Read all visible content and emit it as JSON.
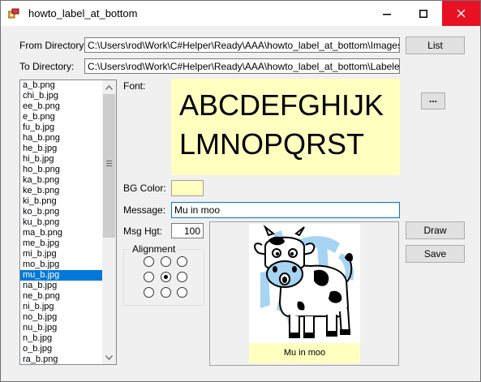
{
  "window": {
    "title": "howto_label_at_bottom",
    "minimize": "—",
    "maximize": "☐",
    "close": "✕"
  },
  "from_directory": {
    "label": "From Directory:",
    "value": "C:\\Users\\rod\\Work\\C#Helper\\Ready\\AAA\\howto_label_at_bottom\\Images"
  },
  "to_directory": {
    "label": "To Directory:",
    "value": "C:\\Users\\rod\\Work\\C#Helper\\Ready\\AAA\\howto_label_at_bottom\\Labeled"
  },
  "buttons": {
    "list": "List",
    "font_picker": "...",
    "draw": "Draw",
    "save": "Save"
  },
  "files": [
    "a_b.png",
    "chi_b.jpg",
    "ee_b.png",
    "e_b.png",
    "fu_b.jpg",
    "ha_b.png",
    "he_b.jpg",
    "hi_b.jpg",
    "ho_b.png",
    "ka_b.png",
    "ke_b.png",
    "ki_b.png",
    "ko_b.png",
    "ku_b.png",
    "ma_b.png",
    "me_b.jpg",
    "mi_b.jpg",
    "mo_b.jpg",
    "mu_b.jpg",
    "na_b.jpg",
    "ne_b.png",
    "ni_b.jpg",
    "no_b.jpg",
    "nu_b.jpg",
    "n_b.jpg",
    "o_b.jpg",
    "ra_b.png"
  ],
  "selected_file": "mu_b.jpg",
  "font": {
    "label": "Font:",
    "sample_line1": "ABCDEFGHIJK",
    "sample_line2": "LMNOPQRST"
  },
  "bg_color": {
    "label": "BG Color:",
    "value": "#ffffc0"
  },
  "message": {
    "label": "Message:",
    "value": "Mu in moo"
  },
  "msg_height": {
    "label": "Msg Hgt:",
    "value": "100"
  },
  "alignment": {
    "label": "Alignment",
    "selected": "middle-center"
  },
  "preview": {
    "caption": "Mu in moo"
  },
  "colors": {
    "accent": "#0078d7",
    "close_red": "#e81123",
    "label_bg": "#ffffc0"
  }
}
